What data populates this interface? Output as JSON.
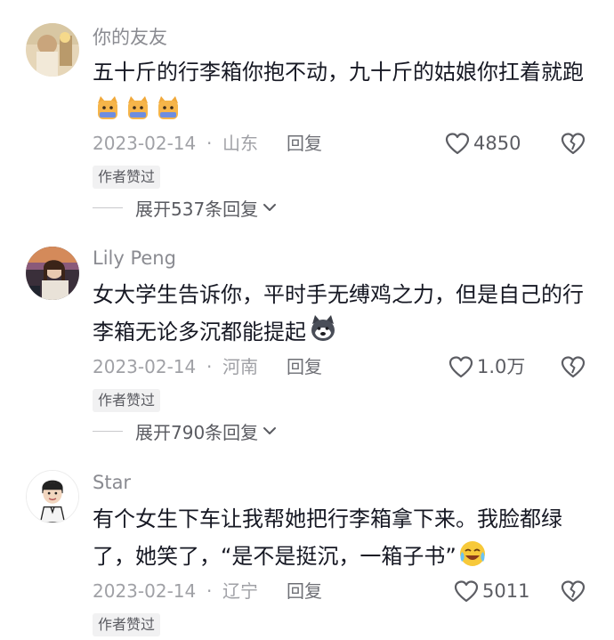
{
  "comments": [
    {
      "username": "你的友友",
      "text": "五十斤的行李箱你抱不动，九十斤的姑娘你扛着就跑",
      "emojis": [
        "cat-emoji",
        "cat-emoji",
        "cat-emoji"
      ],
      "date": "2023-02-14",
      "dot": "·",
      "region": "山东",
      "reply_label": "回复",
      "likes": "4850",
      "badge": "作者赞过",
      "expand_label": "展开537条回复"
    },
    {
      "username": "Lily Peng",
      "text": "女大学生告诉你，平时手无缚鸡之力，但是自己的行李箱无论多沉都能提起",
      "emojis": [
        "husky-emoji"
      ],
      "date": "2023-02-14",
      "dot": "·",
      "region": "河南",
      "reply_label": "回复",
      "likes": "1.0万",
      "badge": "作者赞过",
      "expand_label": "展开790条回复"
    },
    {
      "username": "Star",
      "text": "有个女生下车让我帮她把行李箱拿下来。我脸都绿了，她笑了，“是不是挺沉，一箱子书”",
      "emojis": [
        "crying-laugh-emoji"
      ],
      "date": "2023-02-14",
      "dot": "·",
      "region": "辽宁",
      "reply_label": "回复",
      "likes": "5011",
      "badge": "作者赞过"
    }
  ],
  "icons": {
    "like": "heart-outline-icon",
    "dislike": "broken-heart-icon",
    "expand": "chevron-down-icon"
  },
  "colors": {
    "username": "#8a8b91",
    "meta": "#a0a1a6",
    "badge_bg": "#f1f1f2",
    "text": "#161823"
  }
}
